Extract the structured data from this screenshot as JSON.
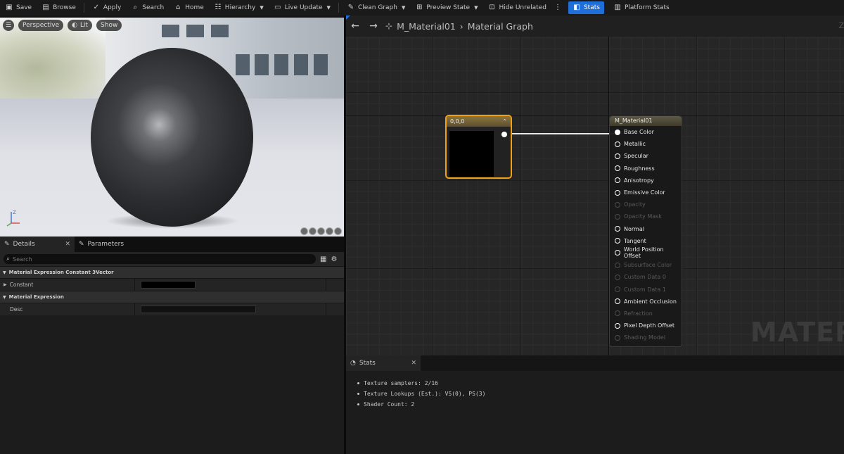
{
  "toolbar": {
    "items": [
      {
        "label": "Save",
        "icon": "save-icon"
      },
      {
        "label": "Browse",
        "icon": "folder-icon"
      },
      {
        "label": "Apply",
        "icon": "apply-icon"
      },
      {
        "label": "Search",
        "icon": "search-icon"
      },
      {
        "label": "Home",
        "icon": "home-icon"
      },
      {
        "label": "Hierarchy",
        "icon": "hierarchy-icon"
      },
      {
        "label": "Live Update",
        "icon": "live-update-icon"
      },
      {
        "label": "Clean Graph",
        "icon": "clean-graph-icon"
      },
      {
        "label": "Preview State",
        "icon": "preview-state-icon"
      },
      {
        "label": "Hide Unrelated",
        "icon": "hide-unrelated-icon"
      },
      {
        "label": "Stats",
        "icon": "stats-icon"
      },
      {
        "label": "Platform Stats",
        "icon": "platform-stats-icon"
      }
    ]
  },
  "viewport": {
    "perspective_label": "Perspective",
    "lit_label": "Lit",
    "show_label": "Show",
    "accent_color": "#1e6fd9"
  },
  "details": {
    "tab_details": "Details",
    "tab_parameters": "Parameters",
    "search_placeholder": "Search",
    "category1": "Material Expression Constant 3Vector",
    "prop_constant": "Constant",
    "category2": "Material Expression",
    "prop_desc": "Desc"
  },
  "graph": {
    "breadcrumb_asset": "M_Material01",
    "breadcrumb_graph": "Material Graph",
    "zoom_label": "Z",
    "const_node_title": "0,0,0",
    "material_node_title": "M_Material01",
    "pins": [
      {
        "label": "Base Color",
        "enabled": true,
        "connected": true
      },
      {
        "label": "Metallic",
        "enabled": true
      },
      {
        "label": "Specular",
        "enabled": true
      },
      {
        "label": "Roughness",
        "enabled": true
      },
      {
        "label": "Anisotropy",
        "enabled": true
      },
      {
        "label": "Emissive Color",
        "enabled": true
      },
      {
        "label": "Opacity",
        "enabled": false
      },
      {
        "label": "Opacity Mask",
        "enabled": false
      },
      {
        "label": "Normal",
        "enabled": true
      },
      {
        "label": "Tangent",
        "enabled": true
      },
      {
        "label": "World Position Offset",
        "enabled": true
      },
      {
        "label": "Subsurface Color",
        "enabled": false
      },
      {
        "label": "Custom Data 0",
        "enabled": false
      },
      {
        "label": "Custom Data 1",
        "enabled": false
      },
      {
        "label": "Ambient Occlusion",
        "enabled": true
      },
      {
        "label": "Refraction",
        "enabled": false
      },
      {
        "label": "Pixel Depth Offset",
        "enabled": true
      },
      {
        "label": "Shading Model",
        "enabled": false
      }
    ],
    "watermark": "MATERIA"
  },
  "stats": {
    "tab_label": "Stats",
    "lines": [
      "Texture samplers: 2/16",
      "Texture Lookups (Est.): VS(0), PS(3)",
      "Shader Count: 2"
    ]
  }
}
